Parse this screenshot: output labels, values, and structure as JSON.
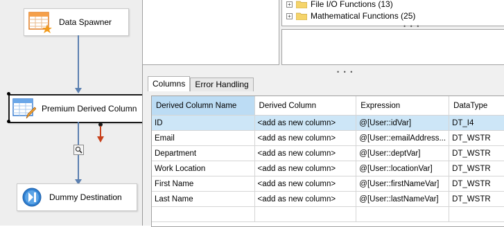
{
  "canvas": {
    "nodes": [
      {
        "label": "Data Spawner",
        "icon": "table-star-icon"
      },
      {
        "label": "Premium Derived Column",
        "icon": "table-pencil-icon"
      },
      {
        "label": "Dummy Destination",
        "icon": "destination-icon"
      }
    ]
  },
  "function_tree": {
    "items": [
      {
        "label": "File I/O Functions (13)"
      },
      {
        "label": "Mathematical Functions (25)"
      }
    ]
  },
  "tabs": [
    {
      "label": "Columns",
      "active": true
    },
    {
      "label": "Error Handling",
      "active": false
    }
  ],
  "grid": {
    "headers": [
      "Derived Column Name",
      "Derived Column",
      "Expression",
      "DataType"
    ],
    "rows": [
      [
        "ID",
        "<add as new column>",
        "@[User::idVar]",
        "DT_I4"
      ],
      [
        "Email",
        "<add as new column>",
        "@[User::emailAddress...",
        "DT_WSTR"
      ],
      [
        "Department",
        "<add as new column>",
        "@[User::deptVar]",
        "DT_WSTR"
      ],
      [
        "Work Location",
        "<add as new column>",
        "@[User::locationVar]",
        "DT_WSTR"
      ],
      [
        "First Name",
        "<add as new column>",
        "@[User::firstNameVar]",
        "DT_WSTR"
      ],
      [
        "Last Name",
        "<add as new column>",
        "@[User::lastNameVar]",
        "DT_WSTR"
      ]
    ]
  },
  "colors": {
    "flow_arrow": "#5a7fb0",
    "error_arrow": "#c8411c",
    "selected_row": "#cde6f7",
    "sorted_header": "#bcdcf4"
  }
}
